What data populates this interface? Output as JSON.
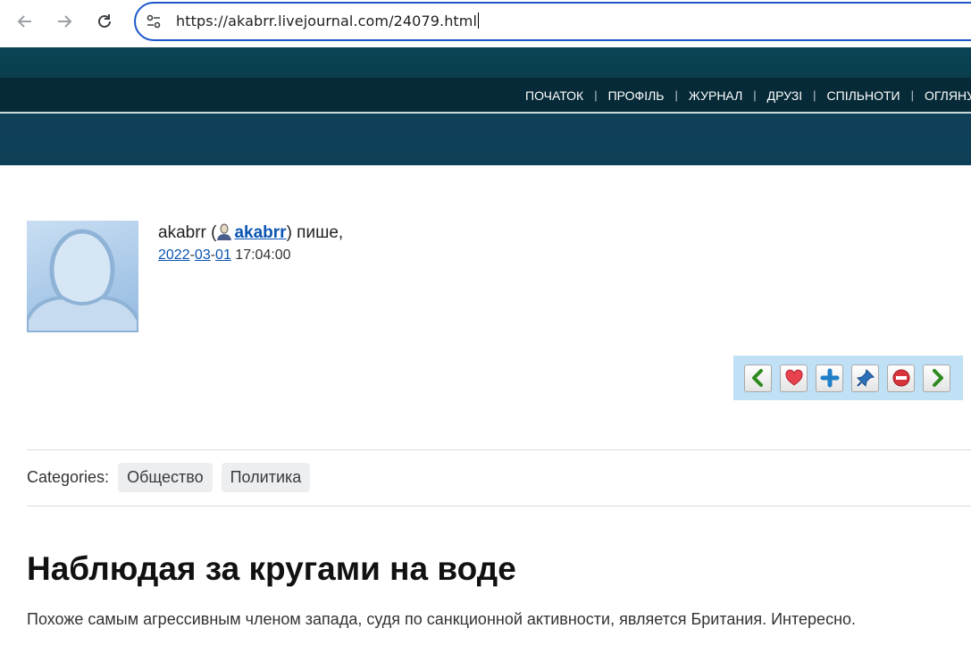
{
  "browser": {
    "url": "https://akabrr.livejournal.com/24079.html"
  },
  "topnav": {
    "items": [
      {
        "label": "ПОЧАТОК"
      },
      {
        "label": "ПРОФІЛЬ"
      },
      {
        "label": "ЖУРНАЛ"
      },
      {
        "label": "ДРУЗІ"
      },
      {
        "label": "СПІЛЬНОТИ"
      },
      {
        "label": "ОГЛЯНУ"
      }
    ]
  },
  "entry": {
    "poster_name": "akabrr",
    "open_paren": " (",
    "ljuser": "akabrr",
    "writes": ") пише,",
    "date_year": "2022",
    "date_month": "03",
    "date_day": "01",
    "time": "17:04:00",
    "categories_label": "Categories:",
    "categories": [
      "Общество",
      "Политика"
    ],
    "title": "Наблюдая за кругами на воде",
    "text": "Похоже самым агрессивным членом запада, судя по санкционной активности, является Британия. Интересно."
  },
  "actions": [
    {
      "icon": "prev-entry-icon"
    },
    {
      "icon": "heart-icon"
    },
    {
      "icon": "add-icon"
    },
    {
      "icon": "pin-icon"
    },
    {
      "icon": "block-icon"
    },
    {
      "icon": "next-entry-icon"
    }
  ],
  "colors": {
    "header_dark": "#062a37",
    "header_teal": "#0b4555",
    "link": "#0b55b2",
    "action_bar": "#bfe0f5",
    "address_border": "#1b57c9"
  }
}
